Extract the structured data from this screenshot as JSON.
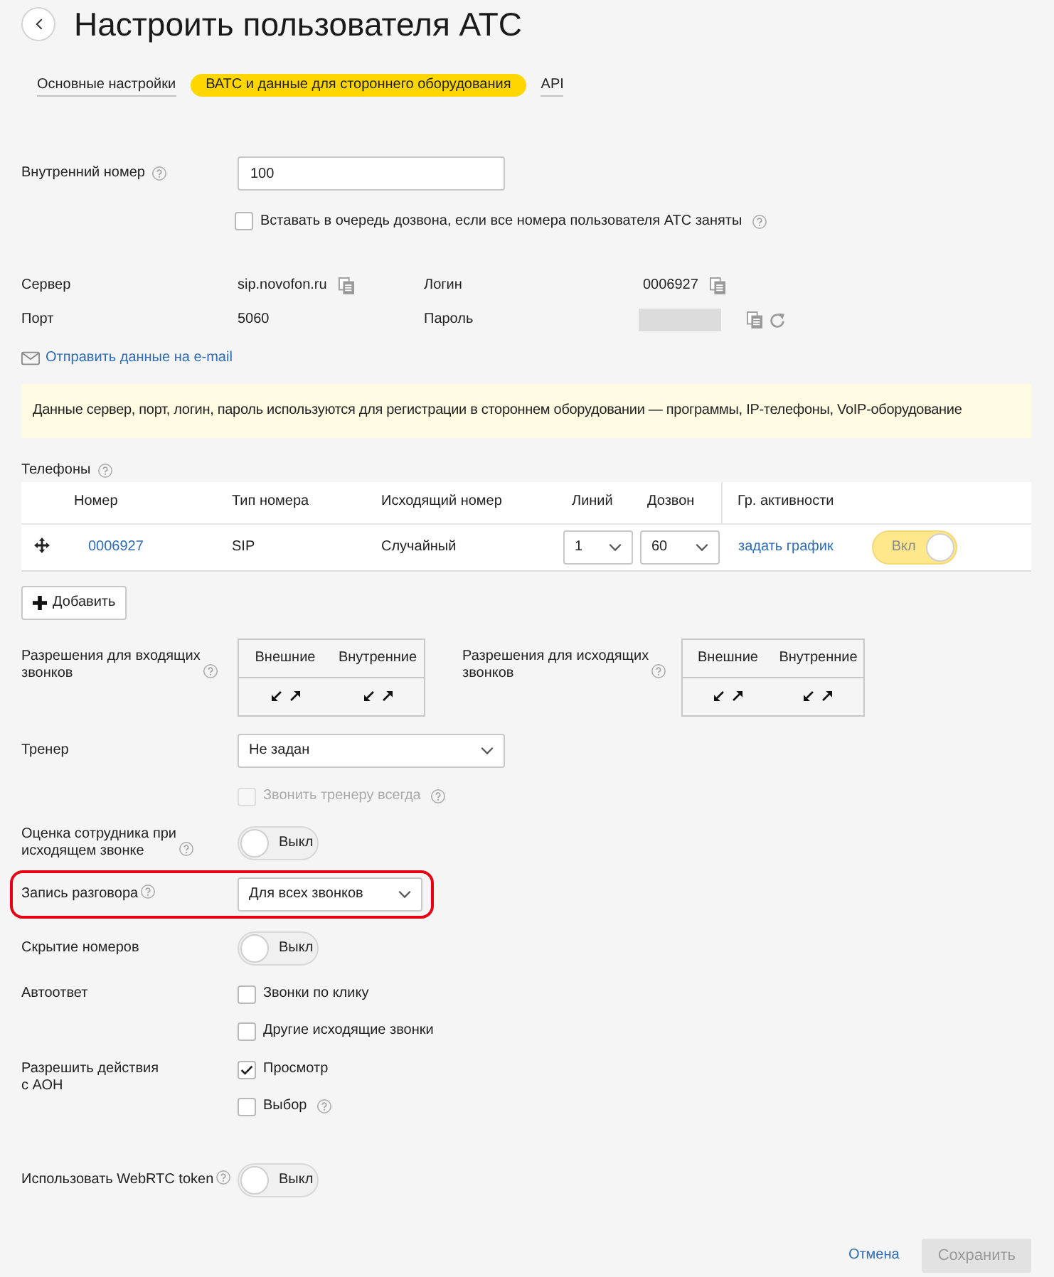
{
  "title": "Настроить пользователя АТС",
  "tabs": [
    {
      "label": "Основные настройки",
      "selected": false
    },
    {
      "label": "ВАТС и данные для стороннего оборудования",
      "selected": true
    },
    {
      "label": "API",
      "selected": false
    }
  ],
  "extension": {
    "label": "Внутренний номер",
    "help": true,
    "value": "100"
  },
  "queue": {
    "label": "Вставать в очередь дозвона, если все номера пользователя АТС заняты",
    "checked": false,
    "help": true
  },
  "credentials": [
    {
      "label": "Сервер",
      "value": "sip.novofon.ru",
      "copy": true
    },
    {
      "label": "Логин",
      "value": "0006927",
      "copy": true
    },
    {
      "label": "Порт",
      "value": "5060"
    },
    {
      "label": "Пароль",
      "masked": true,
      "copy": true,
      "reset": true
    }
  ],
  "email_link": "Отправить данные на e-mail",
  "notice": "Данные сервер, порт, логин, пароль используются для регистрации в стороннем оборудовании — программы, IP-телефоны, VoIP-оборудование",
  "phones": {
    "label": "Телефоны",
    "help": true,
    "columns": [
      "Номер",
      "Тип номера",
      "Исходящий номер",
      "Линий",
      "Дозвон",
      "Гр. активности"
    ],
    "rows": [
      {
        "number": "0006927",
        "type": "SIP",
        "outgoing": "Случайный",
        "lines": "1",
        "dial": "60",
        "schedule": "задать график",
        "active": {
          "label": "Вкл",
          "on": true
        }
      }
    ]
  },
  "add_button": "Добавить",
  "permissions": [
    {
      "label": [
        "Разрешения для входящих",
        "звонков"
      ],
      "help": true,
      "columns": [
        "Внешние",
        "Внутренние"
      ]
    },
    {
      "label": [
        "Разрешения для исходящих",
        "звонков"
      ],
      "help": true,
      "columns": [
        "Внешние",
        "Внутренние"
      ]
    }
  ],
  "settings": [
    {
      "kind": "select",
      "label": [
        "Тренер"
      ],
      "value": "Не задан"
    },
    {
      "kind": "checkboxes",
      "options": [
        {
          "label": "Звонить тренеру всегда",
          "checked": false,
          "disabled": true,
          "help": true
        }
      ]
    },
    {
      "kind": "toggle",
      "label": [
        "Оценка сотрудника при",
        "исходящем звонке"
      ],
      "help": true,
      "toggle": {
        "label": "Выкл",
        "on": false
      }
    },
    {
      "kind": "select",
      "label": [
        "Запись разговора"
      ],
      "help": true,
      "value": "Для всех звонков",
      "highlighted": true
    },
    {
      "kind": "toggle",
      "label": [
        "Скрытие номеров"
      ],
      "toggle": {
        "label": "Выкл",
        "on": false
      }
    },
    {
      "kind": "checkboxes",
      "label": [
        "Автоответ"
      ],
      "options": [
        {
          "label": "Звонки по клику",
          "checked": false
        },
        {
          "label": "Другие исходящие звонки",
          "checked": false
        }
      ]
    },
    {
      "kind": "checkboxes",
      "label": [
        "Разрешить действия",
        "с АОН"
      ],
      "options": [
        {
          "label": "Просмотр",
          "checked": true
        },
        {
          "label": "Выбор",
          "checked": false,
          "help": true
        }
      ]
    },
    {
      "kind": "toggle",
      "label": [
        "Использовать WebRTC token"
      ],
      "help": true,
      "toggle": {
        "label": "Выкл",
        "on": false
      }
    }
  ],
  "footer": {
    "cancel": "Отмена",
    "save": {
      "label": "Сохранить",
      "disabled": true
    }
  }
}
